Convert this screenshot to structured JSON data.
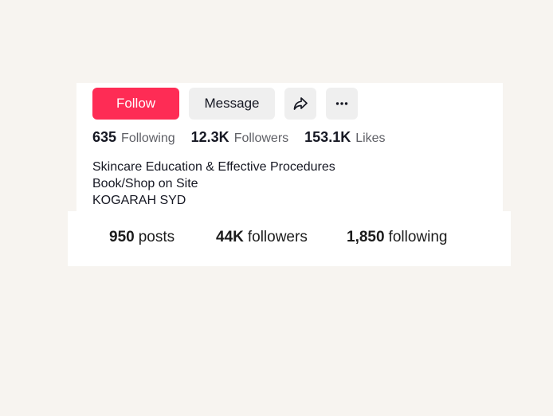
{
  "profile": {
    "buttons": {
      "follow_label": "Follow",
      "message_label": "Message",
      "share_icon": "share-arrow-icon",
      "more_icon": "more-horizontal-icon"
    },
    "stats": [
      {
        "value": "635",
        "label": "Following"
      },
      {
        "value": "12.3K",
        "label": "Followers"
      },
      {
        "value": "153.1K",
        "label": "Likes"
      }
    ],
    "bio": [
      "Skincare Education & Effective Procedures",
      "Book/Shop on Site",
      "KOGARAH SYD"
    ]
  },
  "instagram_stats": {
    "posts": {
      "value": "950",
      "label": "posts"
    },
    "followers": {
      "value": "44K",
      "label": "followers"
    },
    "following": {
      "value": "1,850",
      "label": "following"
    }
  },
  "colors": {
    "background": "#f7f4f0",
    "follow_button": "#fe2c55",
    "secondary_button": "#efefef"
  }
}
